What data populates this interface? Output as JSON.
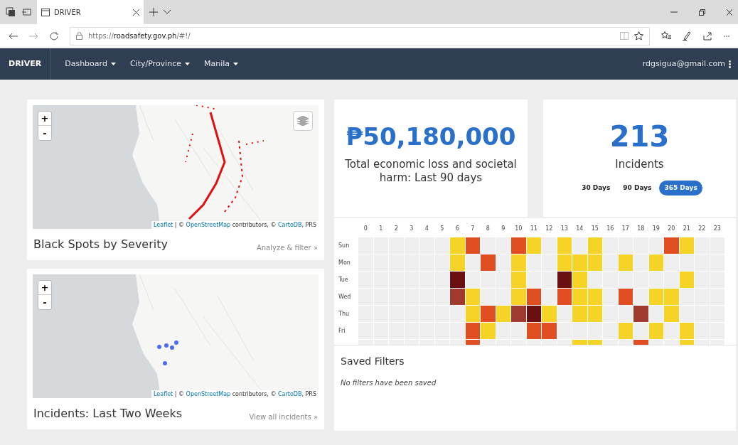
{
  "browser": {
    "tab_title": "DRIVER",
    "url_prefix": "https://",
    "url_host": "roadsafety.gov.ph",
    "url_path": "/#!/"
  },
  "navbar": {
    "brand": "DRIVER",
    "menus": [
      {
        "label": "Dashboard"
      },
      {
        "label": "City/Province"
      },
      {
        "label": "Manila"
      }
    ],
    "user": "rdgsigua@gmail.com"
  },
  "maps": [
    {
      "kind": "blackspots",
      "title": "Black Spots by Severity",
      "link": "Analyze & filter »",
      "attribution": {
        "leaflet": "Leaflet",
        "sep1": "| ©",
        "osm": "OpenStreetMap",
        "mid": "contributors, ©",
        "carto": "CartoDB",
        "end": ", PRS"
      },
      "zoom_in": "+",
      "zoom_out": "-",
      "layers_button": true
    },
    {
      "kind": "incidents",
      "title": "Incidents: Last Two Weeks",
      "link": "View all incidents »",
      "attribution": {
        "leaflet": "Leaflet",
        "sep1": "| ©",
        "osm": "OpenStreetMap",
        "mid": "contributors, ©",
        "carto": "CartoDB",
        "end": ", PRS"
      },
      "zoom_in": "+",
      "zoom_out": "-",
      "layers_button": false
    }
  ],
  "loss": {
    "value": "₱50,180,000",
    "caption": "Total economic loss and societal harm: Last 90 days"
  },
  "incidents": {
    "value": "213",
    "caption": "Incidents",
    "ranges": [
      {
        "label": "30 Days",
        "selected": false
      },
      {
        "label": "90 Days",
        "selected": false
      },
      {
        "label": "365 Days",
        "selected": true
      }
    ]
  },
  "heatmap": {
    "hours": [
      "0",
      "1",
      "2",
      "3",
      "4",
      "5",
      "6",
      "7",
      "8",
      "9",
      "10",
      "11",
      "12",
      "13",
      "14",
      "15",
      "16",
      "17",
      "18",
      "19",
      "20",
      "21",
      "22",
      "23"
    ],
    "rows": [
      {
        "label": "Sun",
        "cells": [
          {
            "color": "#efefef"
          },
          {
            "color": "#efefef"
          },
          {
            "color": "#efefef"
          },
          {
            "color": "#efefef"
          },
          {
            "color": "#efefef"
          },
          {
            "color": "#efefef"
          },
          {
            "color": "#f5d327"
          },
          {
            "color": "#e04e22"
          },
          {
            "color": "#efefef"
          },
          {
            "color": "#efefef"
          },
          {
            "color": "#e04e22"
          },
          {
            "color": "#f5d327"
          },
          {
            "color": "#efefef"
          },
          {
            "color": "#f5d327"
          },
          {
            "color": "#efefef"
          },
          {
            "color": "#f5d327"
          },
          {
            "color": "#efefef"
          },
          {
            "color": "#efefef"
          },
          {
            "color": "#efefef"
          },
          {
            "color": "#efefef"
          },
          {
            "color": "#e04e22"
          },
          {
            "color": "#f5d327"
          },
          {
            "color": "#efefef"
          },
          {
            "color": "#efefef"
          }
        ]
      },
      {
        "label": "Mon",
        "cells": [
          {
            "color": "#efefef"
          },
          {
            "color": "#efefef"
          },
          {
            "color": "#efefef"
          },
          {
            "color": "#efefef"
          },
          {
            "color": "#efefef"
          },
          {
            "color": "#efefef"
          },
          {
            "color": "#f5d327"
          },
          {
            "color": "#efefef"
          },
          {
            "color": "#e04e22"
          },
          {
            "color": "#efefef"
          },
          {
            "color": "#f5d327"
          },
          {
            "color": "#efefef"
          },
          {
            "color": "#efefef"
          },
          {
            "color": "#f5d327"
          },
          {
            "color": "#f5d327"
          },
          {
            "color": "#f5d327"
          },
          {
            "color": "#efefef"
          },
          {
            "color": "#f5d327"
          },
          {
            "color": "#efefef"
          },
          {
            "color": "#f5d327"
          },
          {
            "color": "#efefef"
          },
          {
            "color": "#efefef"
          },
          {
            "color": "#efefef"
          },
          {
            "color": "#efefef"
          }
        ]
      },
      {
        "label": "Tue",
        "cells": [
          {
            "color": "#efefef"
          },
          {
            "color": "#efefef"
          },
          {
            "color": "#efefef"
          },
          {
            "color": "#efefef"
          },
          {
            "color": "#efefef"
          },
          {
            "color": "#efefef"
          },
          {
            "color": "#6b0f12"
          },
          {
            "color": "#efefef"
          },
          {
            "color": "#efefef"
          },
          {
            "color": "#efefef"
          },
          {
            "color": "#f5d327"
          },
          {
            "color": "#efefef"
          },
          {
            "color": "#efefef"
          },
          {
            "color": "#6b0f12"
          },
          {
            "color": "#f5d327"
          },
          {
            "color": "#efefef"
          },
          {
            "color": "#efefef"
          },
          {
            "color": "#efefef"
          },
          {
            "color": "#efefef"
          },
          {
            "color": "#efefef"
          },
          {
            "color": "#efefef"
          },
          {
            "color": "#f5d327"
          },
          {
            "color": "#efefef"
          },
          {
            "color": "#efefef"
          }
        ]
      },
      {
        "label": "Wed",
        "cells": [
          {
            "color": "#efefef"
          },
          {
            "color": "#efefef"
          },
          {
            "color": "#efefef"
          },
          {
            "color": "#efefef"
          },
          {
            "color": "#efefef"
          },
          {
            "color": "#efefef"
          },
          {
            "color": "#a13a2e"
          },
          {
            "color": "#f5d327"
          },
          {
            "color": "#efefef"
          },
          {
            "color": "#efefef"
          },
          {
            "color": "#f5d327"
          },
          {
            "color": "#e04e22"
          },
          {
            "color": "#efefef"
          },
          {
            "color": "#e04e22"
          },
          {
            "color": "#f5d327"
          },
          {
            "color": "#f5d327"
          },
          {
            "color": "#efefef"
          },
          {
            "color": "#e04e22"
          },
          {
            "color": "#efefef"
          },
          {
            "color": "#f5d327"
          },
          {
            "color": "#f5d327"
          },
          {
            "color": "#efefef"
          },
          {
            "color": "#efefef"
          },
          {
            "color": "#efefef"
          }
        ]
      },
      {
        "label": "Thu",
        "cells": [
          {
            "color": "#efefef"
          },
          {
            "color": "#efefef"
          },
          {
            "color": "#efefef"
          },
          {
            "color": "#efefef"
          },
          {
            "color": "#efefef"
          },
          {
            "color": "#efefef"
          },
          {
            "color": "#efefef"
          },
          {
            "color": "#f5d327"
          },
          {
            "color": "#e04e22"
          },
          {
            "color": "#f5d327"
          },
          {
            "color": "#a13a2e"
          },
          {
            "color": "#6b0f12"
          },
          {
            "color": "#f5d327"
          },
          {
            "color": "#efefef"
          },
          {
            "color": "#f5d327"
          },
          {
            "color": "#f5d327"
          },
          {
            "color": "#efefef"
          },
          {
            "color": "#efefef"
          },
          {
            "color": "#a13a2e"
          },
          {
            "color": "#efefef"
          },
          {
            "color": "#f5d327"
          },
          {
            "color": "#efefef"
          },
          {
            "color": "#efefef"
          },
          {
            "color": "#efefef"
          }
        ]
      },
      {
        "label": "Fri",
        "cells": [
          {
            "color": "#efefef"
          },
          {
            "color": "#efefef"
          },
          {
            "color": "#efefef"
          },
          {
            "color": "#efefef"
          },
          {
            "color": "#efefef"
          },
          {
            "color": "#efefef"
          },
          {
            "color": "#efefef"
          },
          {
            "color": "#e04e22"
          },
          {
            "color": "#f5d327"
          },
          {
            "color": "#efefef"
          },
          {
            "color": "#efefef"
          },
          {
            "color": "#e04e22"
          },
          {
            "color": "#e04e22"
          },
          {
            "color": "#efefef"
          },
          {
            "color": "#efefef"
          },
          {
            "color": "#efefef"
          },
          {
            "color": "#efefef"
          },
          {
            "color": "#f5d327"
          },
          {
            "color": "#efefef"
          },
          {
            "color": "#f5d327"
          },
          {
            "color": "#efefef"
          },
          {
            "color": "#f5d327"
          },
          {
            "color": "#efefef"
          },
          {
            "color": "#efefef"
          }
        ]
      },
      {
        "cells": [
          {
            "color": "#efefef"
          },
          {
            "color": "#efefef"
          },
          {
            "color": "#efefef"
          },
          {
            "color": "#efefef"
          },
          {
            "color": "#efefef"
          },
          {
            "color": "#efefef"
          },
          {
            "color": "#efefef"
          },
          {
            "color": "#e04e22"
          },
          {
            "color": "#efefef"
          },
          {
            "color": "#efefef"
          },
          {
            "color": "#efefef"
          },
          {
            "color": "#efefef"
          },
          {
            "color": "#efefef"
          },
          {
            "color": "#efefef"
          },
          {
            "color": "#f5d327"
          },
          {
            "color": "#f5d327"
          },
          {
            "color": "#efefef"
          },
          {
            "color": "#efefef"
          },
          {
            "color": "#e04e22"
          },
          {
            "color": "#efefef"
          },
          {
            "color": "#efefef"
          },
          {
            "color": "#f5d327"
          },
          {
            "color": "#efefef"
          },
          {
            "color": "#efefef"
          }
        ]
      }
    ]
  },
  "saved_filters": {
    "title": "Saved Filters",
    "empty": "No filters have been saved"
  }
}
